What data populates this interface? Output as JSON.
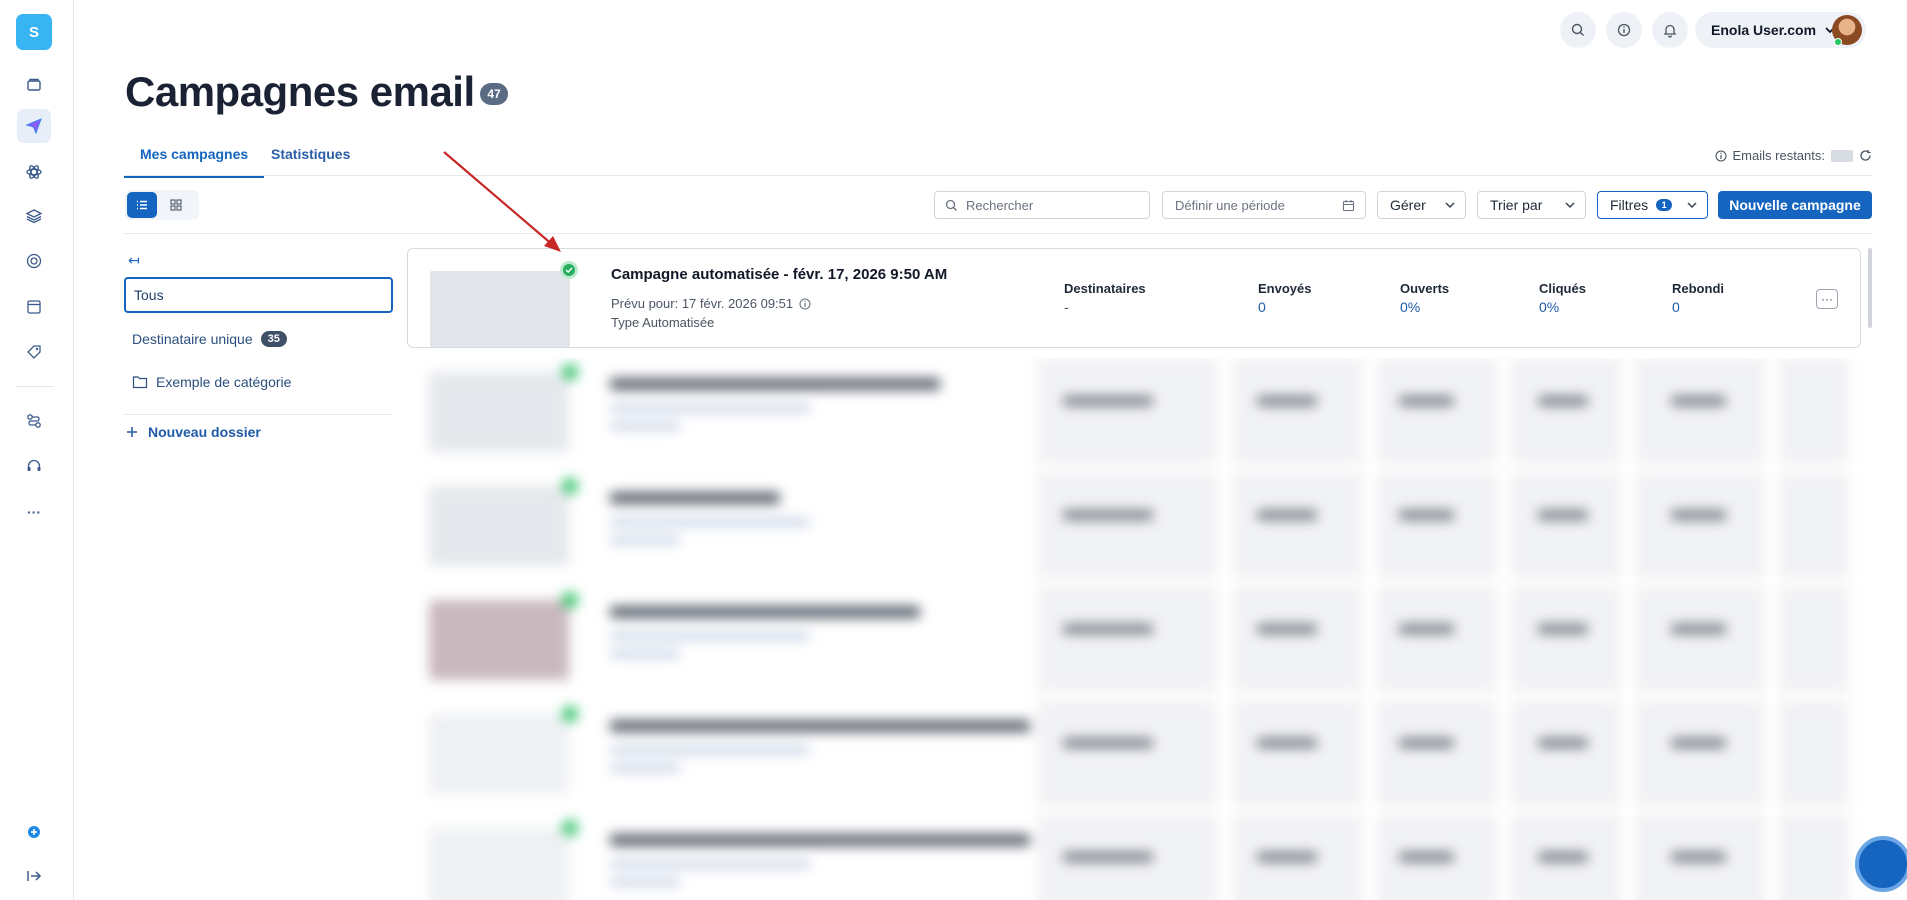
{
  "rail": {
    "logo_letter": "S",
    "items": [
      {
        "icon": "archive-icon"
      },
      {
        "icon": "paper-plane-icon",
        "active": true
      },
      {
        "icon": "atom-icon"
      },
      {
        "icon": "layers-icon"
      },
      {
        "icon": "target-icon"
      },
      {
        "icon": "browser-window-icon"
      },
      {
        "icon": "tag-icon"
      },
      {
        "icon": "route-icon"
      },
      {
        "icon": "headset-icon"
      },
      {
        "icon": "more-dots-icon",
        "label": "···"
      }
    ],
    "bottom": [
      {
        "icon": "plus-circle-icon"
      },
      {
        "icon": "expand-arrow-icon"
      }
    ]
  },
  "topbar": {
    "icons": [
      "search-icon",
      "info-icon",
      "bell-icon"
    ],
    "user_name": "Enola User.com"
  },
  "page": {
    "title": "Campagnes email",
    "count": "47"
  },
  "tabs": [
    {
      "label": "Mes campagnes",
      "active": true
    },
    {
      "label": "Statistiques",
      "active": false
    }
  ],
  "emails_remaining_label": "Emails restants:",
  "toolbar": {
    "search_placeholder": "Rechercher",
    "period_placeholder": "Définir une période",
    "manage_label": "Gérer",
    "sort_label": "Trier par",
    "filters_label": "Filtres",
    "filters_count": "1",
    "new_campaign_label": "Nouvelle campagne"
  },
  "folders": {
    "collapse_label": "↤",
    "items": [
      {
        "label": "Tous",
        "active": true
      },
      {
        "label": "Destinataire unique",
        "count": "35"
      },
      {
        "label": "Exemple de catégorie",
        "icon": "folder-icon"
      }
    ],
    "new_folder_label": "Nouveau dossier"
  },
  "campaign": {
    "title": "Campagne automatisée - févr. 17, 2026 9:50 AM",
    "scheduled": "Prévu pour: 17 févr. 2026 09:51",
    "type": "Type Automatisée",
    "stats": [
      {
        "label": "Destinataires",
        "value": "-"
      },
      {
        "label": "Envoyés",
        "value": "0"
      },
      {
        "label": "Ouverts",
        "value": "0%"
      },
      {
        "label": "Cliqués",
        "value": "0%"
      },
      {
        "label": "Rebondi",
        "value": "0"
      }
    ],
    "more_label": "···"
  },
  "colors": {
    "primary": "#1565c0",
    "logo": "#38b4f2",
    "success": "#27ae60",
    "annotation_arrow": "#c62828"
  }
}
